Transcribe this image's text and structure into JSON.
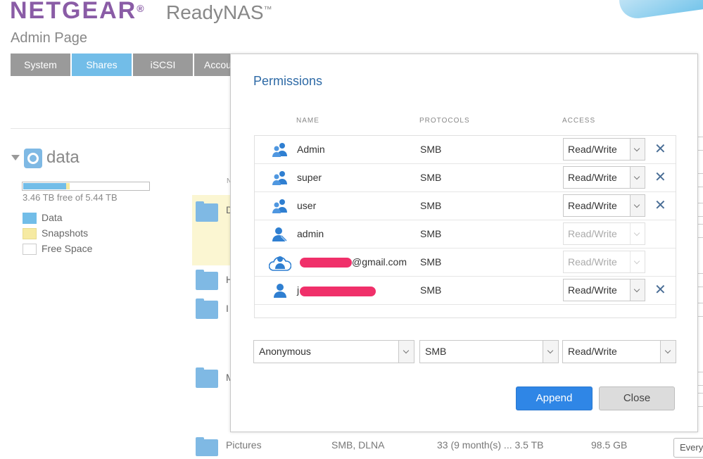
{
  "header": {
    "brand": "NETGEAR",
    "brand_mark": "®",
    "product": "ReadyNAS",
    "product_mark": "™",
    "subtitle": "Admin Page"
  },
  "tabs": [
    {
      "label": "System"
    },
    {
      "label": "Shares"
    },
    {
      "label": "iSCSI"
    },
    {
      "label": "Accou"
    }
  ],
  "volume": {
    "name": "data",
    "used_fraction": 0.34,
    "snapshot_fraction": 0.03,
    "free_text": "3.46 TB free of 5.44 TB",
    "legend": [
      {
        "label": "Data",
        "color": "#72bde8"
      },
      {
        "label": "Snapshots",
        "color": "#f6eaa2"
      },
      {
        "label": "Free Space",
        "color": "#ffffff"
      }
    ]
  },
  "background": {
    "col_fragment": "N",
    "letters": [
      "D",
      "H",
      "I",
      "M"
    ],
    "pictures_row": {
      "name": "Pictures",
      "protocols": "SMB, DLNA",
      "snapshots": "33 (9 month(s) ... 3.5 TB",
      "size": "98.5 GB",
      "select": "Every"
    }
  },
  "dialog": {
    "title": "Permissions",
    "columns": {
      "name": "NAME",
      "protocols": "PROTOCOLS",
      "access": "ACCESS"
    },
    "rows": [
      {
        "name": "Admin",
        "protocol": "SMB",
        "access": "Read/Write"
      },
      {
        "name": "super",
        "protocol": "SMB",
        "access": "Read/Write"
      },
      {
        "name": "user",
        "protocol": "SMB",
        "access": "Read/Write"
      },
      {
        "name": "admin",
        "protocol": "SMB",
        "access": "Read/Write"
      },
      {
        "name": "@gmail.com",
        "protocol": "SMB",
        "access": "Read/Write"
      },
      {
        "name": "j",
        "protocol": "SMB",
        "access": "Read/Write"
      }
    ],
    "add": {
      "user": "Anonymous",
      "protocol": "SMB",
      "access": "Read/Write"
    },
    "append_label": "Append",
    "close_label": "Close"
  }
}
